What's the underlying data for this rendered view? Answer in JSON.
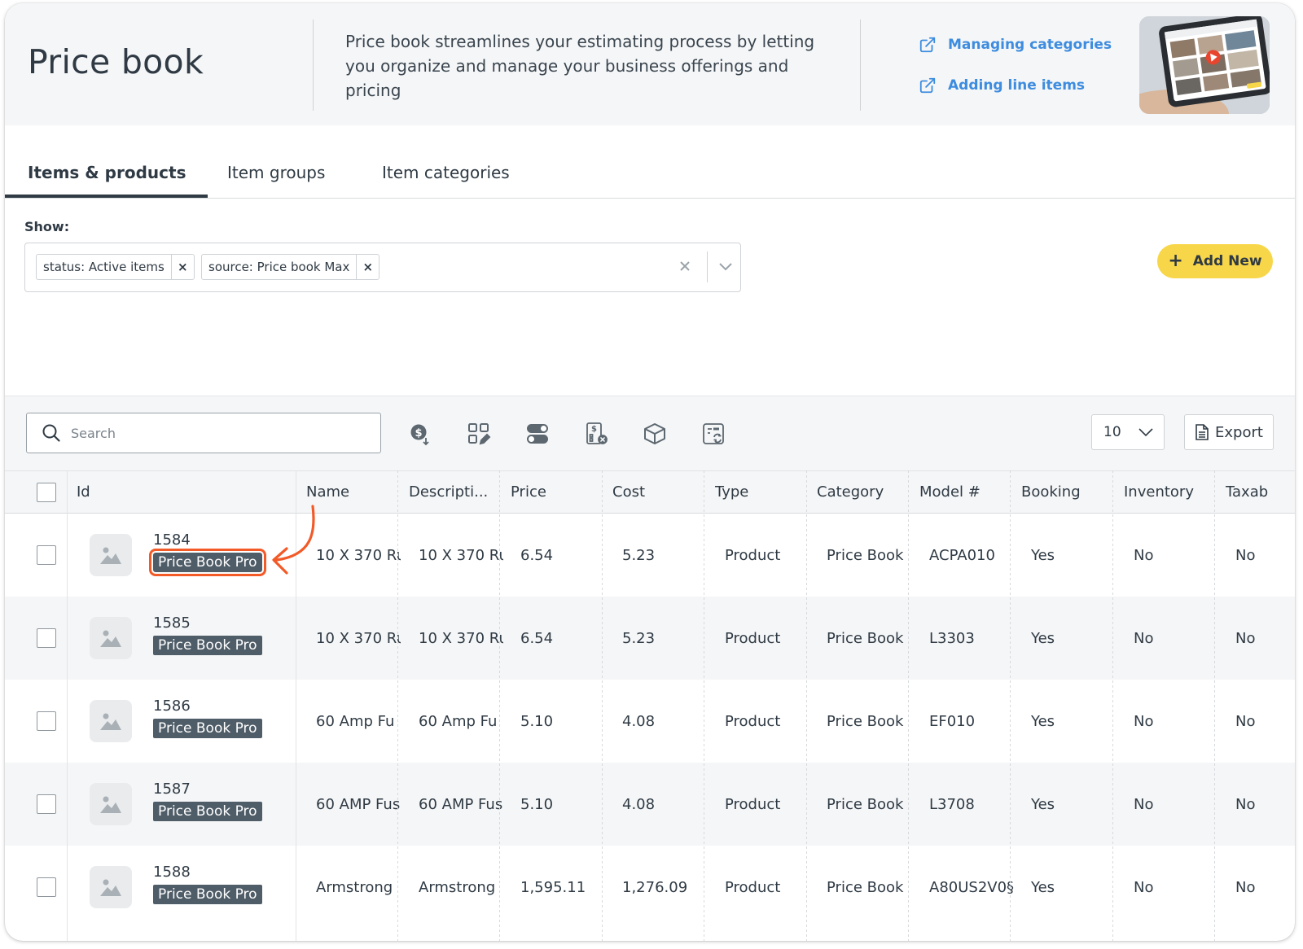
{
  "header": {
    "title": "Price book",
    "description": "Price book streamlines your estimating process by letting you organize and manage your business offerings and pricing",
    "links": [
      "Managing categories",
      "Adding line items"
    ]
  },
  "tabs": [
    "Items & products",
    "Item groups",
    "Item categories"
  ],
  "filters": {
    "label": "Show:",
    "chips": [
      "status: Active items",
      "source: Price book Max"
    ]
  },
  "add_new_label": "Add New",
  "toolbar": {
    "search_placeholder": "Search",
    "page_size": "10",
    "export_label": "Export"
  },
  "table": {
    "columns": [
      "Id",
      "Name",
      "Descripti...",
      "Price",
      "Cost",
      "Type",
      "Category",
      "Model #",
      "Booking",
      "Inventory",
      "Taxab"
    ],
    "rows": [
      {
        "id": "1584",
        "badge": "Price Book Pro",
        "name": "10 X 370 Ru",
        "description": "10 X 370 Ru",
        "price": "6.54",
        "cost": "5.23",
        "type": "Product",
        "category": "Price Book",
        "model": "ACPA010",
        "booking": "Yes",
        "inventory": "No",
        "taxable": "No"
      },
      {
        "id": "1585",
        "badge": "Price Book Pro",
        "name": "10 X 370 Ru",
        "description": "10 X 370 Ru",
        "price": "6.54",
        "cost": "5.23",
        "type": "Product",
        "category": "Price Book",
        "model": "L3303",
        "booking": "Yes",
        "inventory": "No",
        "taxable": "No"
      },
      {
        "id": "1586",
        "badge": "Price Book Pro",
        "name": "60 Amp Fu",
        "description": "60 Amp Fu",
        "price": "5.10",
        "cost": "4.08",
        "type": "Product",
        "category": "Price Book",
        "model": "EF010",
        "booking": "Yes",
        "inventory": "No",
        "taxable": "No"
      },
      {
        "id": "1587",
        "badge": "Price Book Pro",
        "name": "60 AMP Fus",
        "description": "60 AMP Fus",
        "price": "5.10",
        "cost": "4.08",
        "type": "Product",
        "category": "Price Book",
        "model": "L3708",
        "booking": "Yes",
        "inventory": "No",
        "taxable": "No"
      },
      {
        "id": "1588",
        "badge": "Price Book Pro",
        "name": "Armstrong",
        "description": "Armstrong",
        "price": "1,595.11",
        "cost": "1,276.09",
        "type": "Product",
        "category": "Price Book",
        "model": "A80US2V0§",
        "booking": "Yes",
        "inventory": "No",
        "taxable": "No"
      }
    ]
  },
  "colors": {
    "accent_yellow": "#f8d649",
    "link_blue": "#3d8cdf",
    "badge_bg": "#4f5d68",
    "highlight_orange": "#f25a28"
  }
}
